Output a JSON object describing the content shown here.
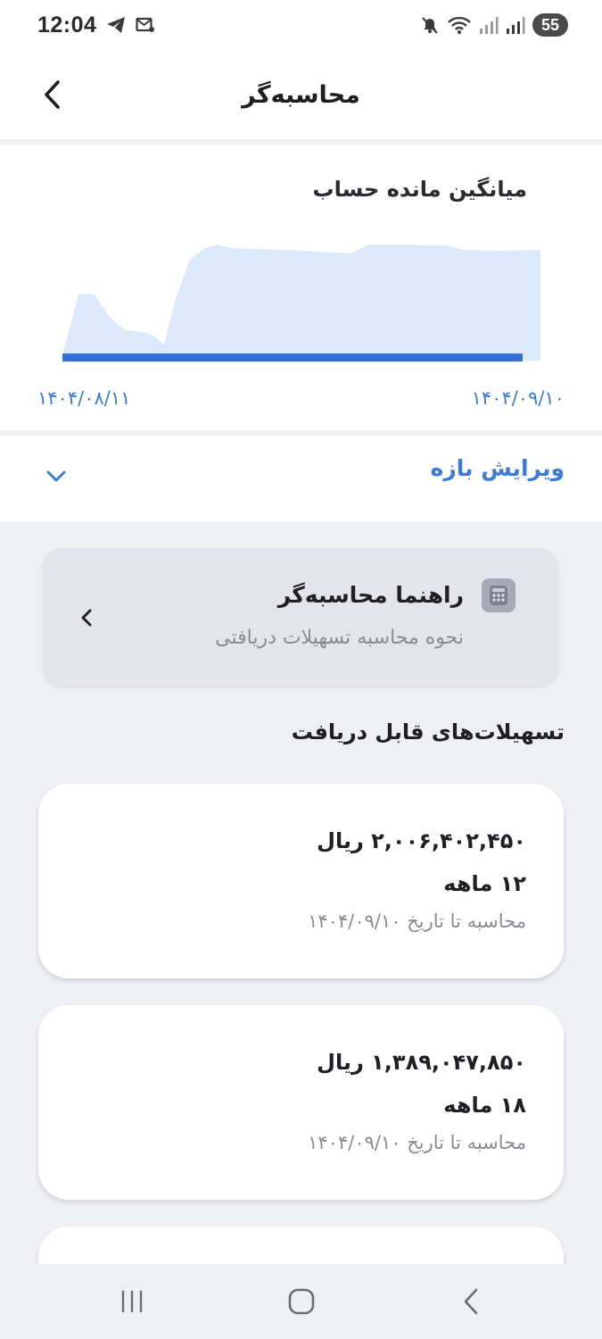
{
  "status_bar": {
    "time": "12:04",
    "battery": "55",
    "icons": [
      "telegram-icon",
      "message-icon",
      "mute-icon",
      "wifi-icon",
      "signal-icon",
      "signal-icon-2"
    ]
  },
  "header": {
    "title": "محاسبه‌گر",
    "back_icon": "chevron-left-icon"
  },
  "chart": {
    "title": "میانگین مانده حساب",
    "date_start": "۱۴۰۴/۰۸/۱۱",
    "date_end": "۱۴۰۴/۰۹/۱۰",
    "fill_color": "#dce9fb",
    "bar_color": "#3570d4"
  },
  "range": {
    "label": "ویرایش بازه",
    "icon": "chevron-down-icon"
  },
  "guide": {
    "title": "راهنما محاسبه‌گر",
    "subtitle": "نحوه محاسبه تسهیلات دریافتی",
    "icon": "calculator-icon"
  },
  "section": {
    "title": "تسهیلات‌های قابل دریافت"
  },
  "facilities": [
    {
      "amount": "۲,۰۰۶,۴۰۲,۴۵۰ ریال",
      "term": "۱۲ ماهه",
      "date_note": "محاسبه تا تاریخ ۱۴۰۴/۰۹/۱۰"
    },
    {
      "amount": "۱,۳۸۹,۰۴۷,۸۵۰ ریال",
      "term": "۱۸ ماهه",
      "date_note": "محاسبه تا تاریخ ۱۴۰۴/۰۹/۱۰"
    }
  ],
  "nav": {
    "recent_icon": "recent-apps-icon",
    "home_icon": "home-icon",
    "back_icon": "back-icon"
  }
}
